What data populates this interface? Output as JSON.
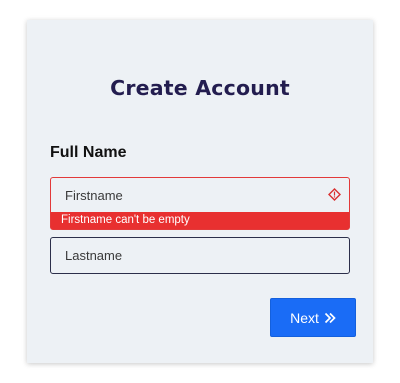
{
  "form": {
    "title": "Create Account",
    "section_label": "Full Name",
    "firstname": {
      "placeholder": "Firstname",
      "value": "",
      "error": "Firstname can't be empty",
      "icon": "warning-diamond-icon"
    },
    "lastname": {
      "placeholder": "Lastname",
      "value": ""
    },
    "next_label": "Next",
    "next_icon": "double-chevron-right-icon"
  },
  "colors": {
    "card_bg": "#edf1f5",
    "title": "#231d4f",
    "error": "#e83030",
    "primary": "#1a6cf6"
  }
}
